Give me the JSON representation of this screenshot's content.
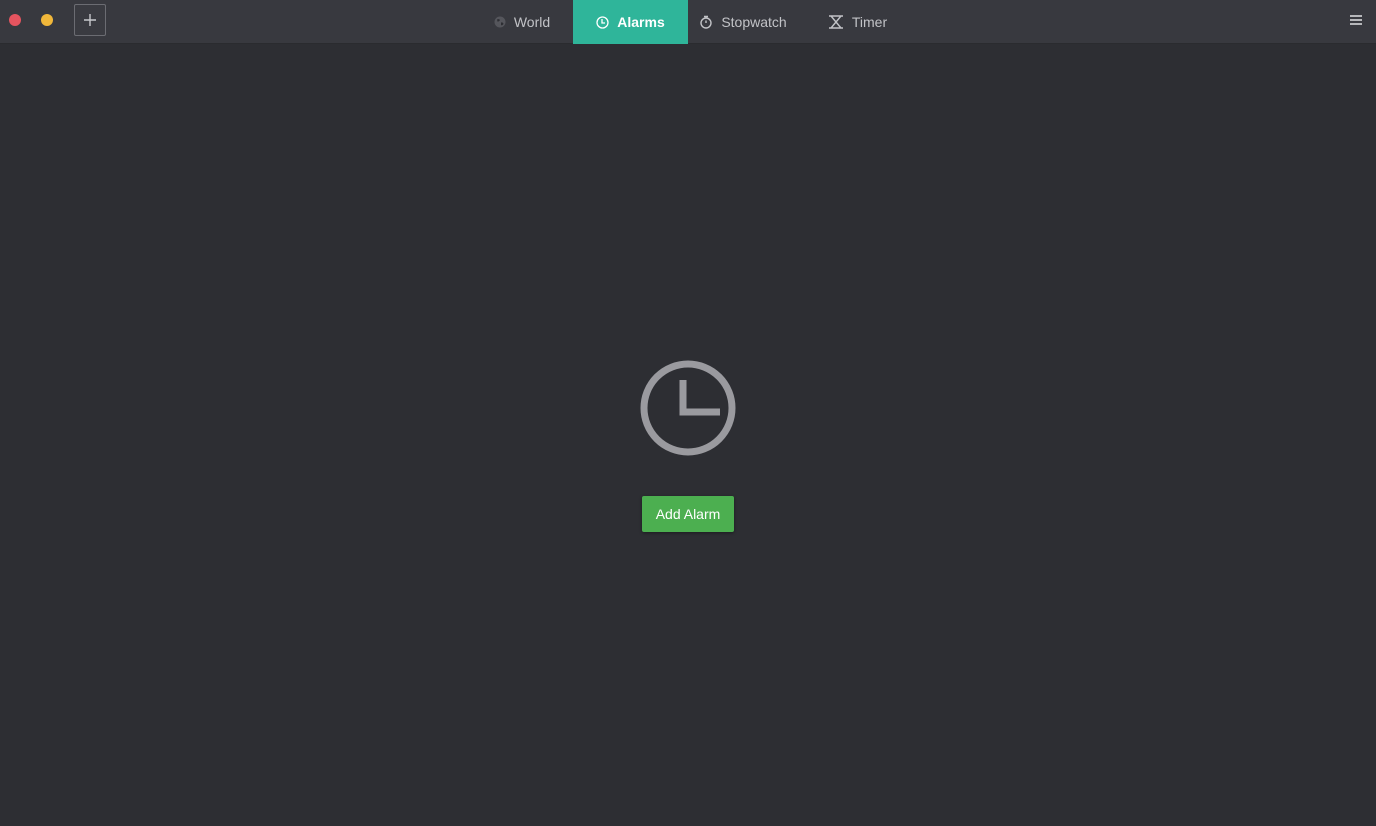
{
  "window": {
    "controls": [
      "close",
      "minimize"
    ],
    "new_button_icon": "plus-icon"
  },
  "tabs": [
    {
      "label": "World",
      "icon": "globe-icon",
      "active": false
    },
    {
      "label": "Alarms",
      "icon": "clock-icon",
      "active": true
    },
    {
      "label": "Stopwatch",
      "icon": "stopwatch-icon",
      "active": false
    },
    {
      "label": "Timer",
      "icon": "hourglass-icon",
      "active": false
    }
  ],
  "menu": {
    "icon": "hamburger-menu-icon"
  },
  "empty_state": {
    "icon": "clock-icon",
    "button_label": "Add Alarm"
  },
  "colors": {
    "background": "#2d2e33",
    "headerbar": "#38393f",
    "accent_tab": "#2fb59a",
    "button": "#4caf50",
    "close": "#e5545f",
    "minimize": "#f0b73a"
  }
}
